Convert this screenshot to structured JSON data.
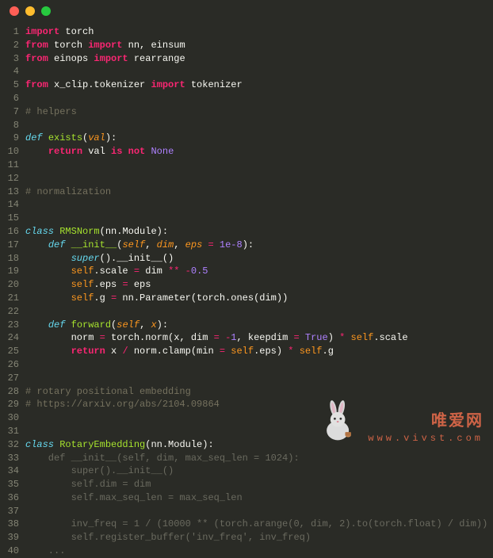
{
  "window": {
    "traffic_lights": [
      "close",
      "minimize",
      "maximize"
    ]
  },
  "code": {
    "lines": [
      {
        "n": 1,
        "tokens": [
          [
            "kw",
            "import"
          ],
          [
            "nm",
            " torch"
          ]
        ]
      },
      {
        "n": 2,
        "tokens": [
          [
            "kw",
            "from"
          ],
          [
            "nm",
            " torch "
          ],
          [
            "kw",
            "import"
          ],
          [
            "nm",
            " nn, einsum"
          ]
        ]
      },
      {
        "n": 3,
        "tokens": [
          [
            "kw",
            "from"
          ],
          [
            "nm",
            " einops "
          ],
          [
            "kw",
            "import"
          ],
          [
            "nm",
            " rearrange"
          ]
        ]
      },
      {
        "n": 4,
        "tokens": []
      },
      {
        "n": 5,
        "tokens": [
          [
            "kw",
            "from"
          ],
          [
            "nm",
            " x_clip.tokenizer "
          ],
          [
            "kw",
            "import"
          ],
          [
            "nm",
            " tokenizer"
          ]
        ]
      },
      {
        "n": 6,
        "tokens": []
      },
      {
        "n": 7,
        "tokens": [
          [
            "cmt",
            "# helpers"
          ]
        ]
      },
      {
        "n": 8,
        "tokens": []
      },
      {
        "n": 9,
        "tokens": [
          [
            "kw2",
            "def "
          ],
          [
            "fn",
            "exists"
          ],
          [
            "nm",
            "("
          ],
          [
            "arg",
            "val"
          ],
          [
            "nm",
            "):"
          ]
        ]
      },
      {
        "n": 10,
        "tokens": [
          [
            "nm",
            "    "
          ],
          [
            "kw",
            "return"
          ],
          [
            "nm",
            " val "
          ],
          [
            "kw",
            "is not "
          ],
          [
            "bool",
            "None"
          ]
        ]
      },
      {
        "n": 11,
        "tokens": []
      },
      {
        "n": 12,
        "tokens": []
      },
      {
        "n": 13,
        "tokens": [
          [
            "cmt",
            "# normalization"
          ]
        ]
      },
      {
        "n": 14,
        "tokens": []
      },
      {
        "n": 15,
        "tokens": []
      },
      {
        "n": 16,
        "tokens": [
          [
            "kw2",
            "class "
          ],
          [
            "cls",
            "RMSNorm"
          ],
          [
            "nm",
            "(nn.Module):"
          ]
        ]
      },
      {
        "n": 17,
        "tokens": [
          [
            "nm",
            "    "
          ],
          [
            "kw2",
            "def "
          ],
          [
            "fn",
            "__init__"
          ],
          [
            "nm",
            "("
          ],
          [
            "arg",
            "self"
          ],
          [
            "nm",
            ", "
          ],
          [
            "arg",
            "dim"
          ],
          [
            "nm",
            ", "
          ],
          [
            "arg",
            "eps"
          ],
          [
            "nm",
            " "
          ],
          [
            "op",
            "="
          ],
          [
            "nm",
            " "
          ],
          [
            "num",
            "1e-8"
          ],
          [
            "nm",
            "):"
          ]
        ]
      },
      {
        "n": 18,
        "tokens": [
          [
            "nm",
            "        "
          ],
          [
            "kw2",
            "super"
          ],
          [
            "nm",
            "().__init__()"
          ]
        ]
      },
      {
        "n": 19,
        "tokens": [
          [
            "nm",
            "        "
          ],
          [
            "self",
            "self"
          ],
          [
            "nm",
            ".scale "
          ],
          [
            "op",
            "="
          ],
          [
            "nm",
            " dim "
          ],
          [
            "op",
            "**"
          ],
          [
            "nm",
            " "
          ],
          [
            "op",
            "-"
          ],
          [
            "num",
            "0.5"
          ]
        ]
      },
      {
        "n": 20,
        "tokens": [
          [
            "nm",
            "        "
          ],
          [
            "self",
            "self"
          ],
          [
            "nm",
            ".eps "
          ],
          [
            "op",
            "="
          ],
          [
            "nm",
            " eps"
          ]
        ]
      },
      {
        "n": 21,
        "tokens": [
          [
            "nm",
            "        "
          ],
          [
            "self",
            "self"
          ],
          [
            "nm",
            ".g "
          ],
          [
            "op",
            "="
          ],
          [
            "nm",
            " nn.Parameter(torch.ones(dim))"
          ]
        ]
      },
      {
        "n": 22,
        "tokens": []
      },
      {
        "n": 23,
        "tokens": [
          [
            "nm",
            "    "
          ],
          [
            "kw2",
            "def "
          ],
          [
            "fn",
            "forward"
          ],
          [
            "nm",
            "("
          ],
          [
            "arg",
            "self"
          ],
          [
            "nm",
            ", "
          ],
          [
            "arg",
            "x"
          ],
          [
            "nm",
            "):"
          ]
        ]
      },
      {
        "n": 24,
        "tokens": [
          [
            "nm",
            "        norm "
          ],
          [
            "op",
            "="
          ],
          [
            "nm",
            " torch.norm(x, dim "
          ],
          [
            "op",
            "="
          ],
          [
            "nm",
            " "
          ],
          [
            "op",
            "-"
          ],
          [
            "num",
            "1"
          ],
          [
            "nm",
            ", keepdim "
          ],
          [
            "op",
            "="
          ],
          [
            "nm",
            " "
          ],
          [
            "bool",
            "True"
          ],
          [
            "nm",
            ") "
          ],
          [
            "op",
            "*"
          ],
          [
            "nm",
            " "
          ],
          [
            "self",
            "self"
          ],
          [
            "nm",
            ".scale"
          ]
        ]
      },
      {
        "n": 25,
        "tokens": [
          [
            "nm",
            "        "
          ],
          [
            "kw",
            "return"
          ],
          [
            "nm",
            " x "
          ],
          [
            "op",
            "/"
          ],
          [
            "nm",
            " norm.clamp(min "
          ],
          [
            "op",
            "="
          ],
          [
            "nm",
            " "
          ],
          [
            "self",
            "self"
          ],
          [
            "nm",
            ".eps) "
          ],
          [
            "op",
            "*"
          ],
          [
            "nm",
            " "
          ],
          [
            "self",
            "self"
          ],
          [
            "nm",
            ".g"
          ]
        ]
      },
      {
        "n": 26,
        "tokens": []
      },
      {
        "n": 27,
        "tokens": []
      },
      {
        "n": 28,
        "tokens": [
          [
            "cmt",
            "# rotary positional embedding"
          ]
        ]
      },
      {
        "n": 29,
        "tokens": [
          [
            "cmt",
            "# https://arxiv.org/abs/2104.09864"
          ]
        ]
      },
      {
        "n": 30,
        "tokens": []
      },
      {
        "n": 31,
        "tokens": []
      },
      {
        "n": 32,
        "tokens": [
          [
            "kw2",
            "class "
          ],
          [
            "cls",
            "RotaryEmbedding"
          ],
          [
            "nm",
            "(nn.Module):"
          ]
        ]
      },
      {
        "n": 33,
        "tokens": [
          [
            "dim",
            "    def __init__(self, dim, max_seq_len = 1024):"
          ]
        ]
      },
      {
        "n": 34,
        "tokens": [
          [
            "dim",
            "        super().__init__()"
          ]
        ]
      },
      {
        "n": 35,
        "tokens": [
          [
            "dim",
            "        self.dim = dim"
          ]
        ]
      },
      {
        "n": 36,
        "tokens": [
          [
            "dim",
            "        self.max_seq_len = max_seq_len"
          ]
        ]
      },
      {
        "n": 37,
        "tokens": []
      },
      {
        "n": 38,
        "tokens": [
          [
            "dim",
            "        inv_freq = 1 / (10000 ** (torch.arange(0, dim, 2).to(torch.float) / dim))"
          ]
        ]
      },
      {
        "n": 39,
        "tokens": [
          [
            "dim",
            "        self.register_buffer('inv_freq', inv_freq)"
          ]
        ]
      },
      {
        "n": 40,
        "tokens": [
          [
            "dim",
            "    ..."
          ]
        ]
      }
    ]
  },
  "watermark": {
    "cn": "唯爱网",
    "url": "www.vivst.com"
  }
}
